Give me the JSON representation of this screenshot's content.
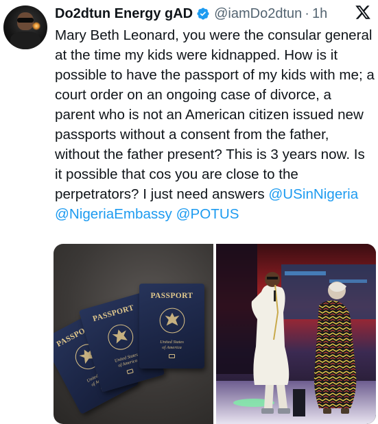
{
  "tweet": {
    "display_name": "Do2dtun Energy gAD",
    "handle": "@iamDo2dtun",
    "separator": "·",
    "time": "1h",
    "text_plain": "Mary Beth Leonard, you were the consular general at the time my kids were kidnapped. How is it possible to have the passport of my kids with me; a court order on an ongoing case of divorce, a parent who is not an American citizen issued new passports without a consent from the father, without the father present? This is 3 years now.  Is it possible that cos you are close to the perpetrators? I just need answers ",
    "mentions": [
      "@USinNigeria",
      "@NigeriaEmbassy",
      "@POTUS"
    ],
    "icons": {
      "verified": "verified-badge-icon",
      "x_logo": "x-logo-icon"
    }
  },
  "media": {
    "passports": [
      {
        "title": "PASSPORT",
        "sub_line1": "United States",
        "sub_line2": "of America"
      },
      {
        "title": "PASSPORT",
        "sub_line1": "United States",
        "sub_line2": "of America"
      },
      {
        "title": "PASSPORT",
        "sub_line1": "United States",
        "sub_line2": "of America"
      }
    ]
  },
  "colors": {
    "mention": "#1d9bf0",
    "verified": "#1d9bf0",
    "secondary_text": "#536471",
    "passport_cover": "#1e2a4d",
    "passport_gold": "#e2c98d"
  }
}
